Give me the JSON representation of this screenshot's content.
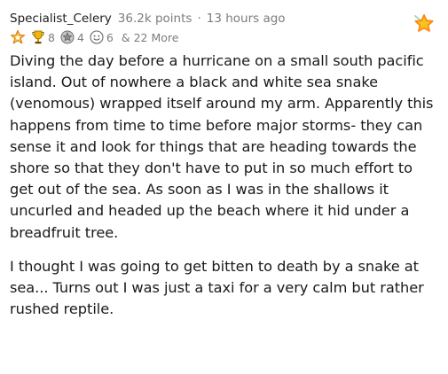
{
  "comment": {
    "username": "Specialist_Celery",
    "points": "36.2k points",
    "separator": "·",
    "age": "13 hours ago",
    "awards": [
      {
        "icon": "star-burst-award-icon",
        "count": ""
      },
      {
        "icon": "trophy-award-icon",
        "count": "8"
      },
      {
        "icon": "silver-medal-award-icon",
        "count": "4"
      },
      {
        "icon": "wholesome-award-icon",
        "count": "6"
      }
    ],
    "more_awards": "& 22 More",
    "top_award_icon": "star-award-icon",
    "paragraphs": [
      "Diving the day before a hurricane on a small south pacific island. Out of nowhere a black and white sea snake (venomous) wrapped itself around my arm. Apparently this happens from time to time before major storms- they can sense it and look for things that are heading towards the shore so that they don't have to put in so much effort to get out of the sea. As soon as I was in the shallows it uncurled and headed up the beach where it hid under a breadfruit tree.",
      "I thought I was going to get bitten to death by a snake at sea... Turns out I was just a taxi for a very calm but rather rushed reptile."
    ]
  },
  "colors": {
    "text": "#1a1a1b",
    "meta": "#7c7c7c",
    "star_gold": "#f5c518",
    "star_orange": "#ff8717"
  }
}
